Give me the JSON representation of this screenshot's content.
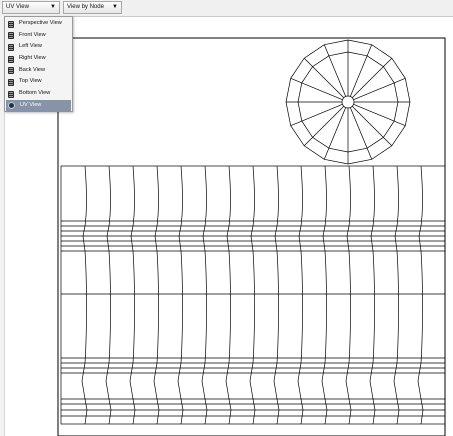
{
  "toolbar": {
    "view_dropdown": {
      "label": "UV View",
      "arrow": "▼"
    },
    "node_dropdown": {
      "label": "View by Node",
      "arrow": "▼"
    }
  },
  "menu": {
    "items": [
      {
        "label": "Perspective View",
        "icon": "camera-icon"
      },
      {
        "label": "Front View",
        "icon": "camera-icon"
      },
      {
        "label": "Left View",
        "icon": "camera-icon"
      },
      {
        "label": "Right View",
        "icon": "camera-icon"
      },
      {
        "label": "Back View",
        "icon": "camera-icon"
      },
      {
        "label": "Top View",
        "icon": "camera-icon"
      },
      {
        "label": "Bottom View",
        "icon": "camera-icon"
      },
      {
        "label": "UV View",
        "icon": "globe-icon",
        "selected": true
      }
    ]
  },
  "viewport": {
    "line_color": "#000000",
    "selection_color": "#8794a8",
    "background": "#ffffff"
  }
}
